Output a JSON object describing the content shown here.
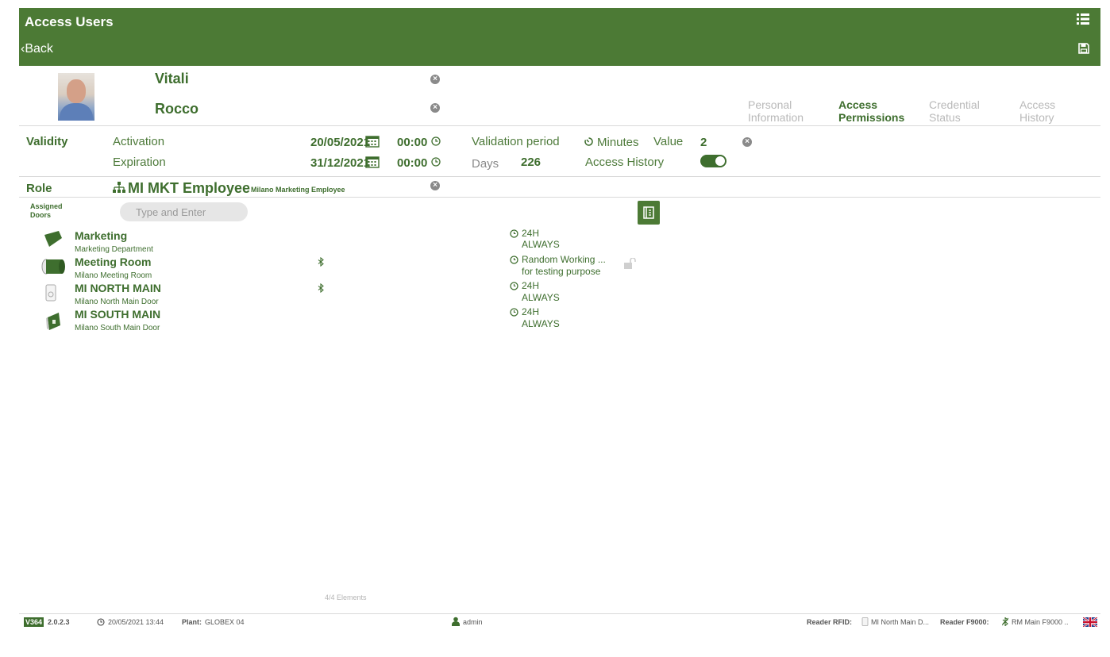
{
  "header": {
    "title": "Access Users",
    "back_label": "Back"
  },
  "user": {
    "last_name": "Vitali",
    "first_name": "Rocco"
  },
  "tabs": [
    {
      "line1": "Personal",
      "line2": "Information",
      "active": false
    },
    {
      "line1": "Access",
      "line2": "Permissions",
      "active": true
    },
    {
      "line1": "Credential",
      "line2": "Status",
      "active": false
    },
    {
      "line1": "Access",
      "line2": "History",
      "active": false
    }
  ],
  "validity": {
    "section_label": "Validity",
    "activation_label": "Activation",
    "activation_date": "20/05/2021",
    "activation_time": "00:00",
    "expiration_label": "Expiration",
    "expiration_date": "31/12/2021",
    "expiration_time": "00:00",
    "validation_period_label": "Validation period",
    "minutes_label": "Minutes",
    "value_label": "Value",
    "value": "2",
    "days_label": "Days",
    "days": "226",
    "access_history_label": "Access History",
    "access_history_enabled": true
  },
  "role": {
    "section_label": "Role",
    "name": "MI MKT Employee",
    "description": "Milano Marketing Employee"
  },
  "doors": {
    "label_line1": "Assigned",
    "label_line2": "Doors",
    "search_placeholder": "Type and Enter",
    "items": [
      {
        "title": "Marketing",
        "subtitle": "Marketing Department",
        "icon": "zone-icon",
        "bluetooth": false
      },
      {
        "title": "Meeting Room",
        "subtitle": "Milano Meeting Room",
        "icon": "cylinder-lock-icon",
        "bluetooth": true
      },
      {
        "title": "MI NORTH MAIN",
        "subtitle": "Milano North Main Door",
        "icon": "wall-reader-icon",
        "bluetooth": true
      },
      {
        "title": "MI SOUTH MAIN",
        "subtitle": "Milano South Main Door",
        "icon": "door-reader-icon",
        "bluetooth": false
      }
    ],
    "schedules": [
      {
        "line1": "24H",
        "line2": "ALWAYS"
      },
      {
        "line1": "Random Working ...",
        "line2": "for testing purpose",
        "lock_icon": true
      },
      {
        "line1": "24H",
        "line2": "ALWAYS"
      },
      {
        "line1": "24H",
        "line2": "ALWAYS"
      }
    ],
    "count_label": "4/4 Elements"
  },
  "footer": {
    "version_badge": "V364",
    "version": "2.0.2.3",
    "datetime": "20/05/2021 13:44",
    "plant_label": "Plant:",
    "plant": "GLOBEX 04",
    "user": "admin",
    "reader_rfid_label": "Reader RFID:",
    "reader_rfid_value": "MI North Main D...",
    "reader_f9000_label": "Reader F9000:",
    "reader_f9000_value": "RM Main F9000 .."
  },
  "colors": {
    "brand_green": "#4c7a35",
    "text_green": "#3e6e2e"
  }
}
